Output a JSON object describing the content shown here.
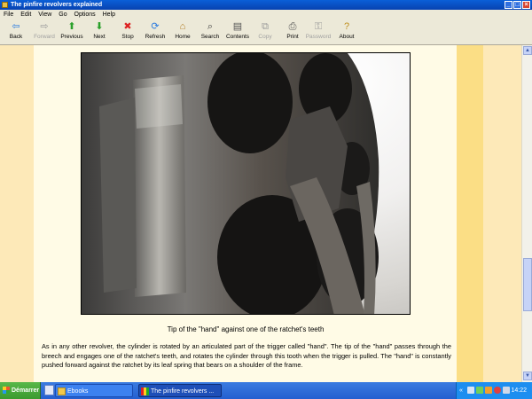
{
  "window": {
    "title": "The pinfire revolvers explained",
    "controls": [
      "_",
      "□",
      "×"
    ]
  },
  "menu": [
    "File",
    "Edit",
    "View",
    "Go",
    "Options",
    "Help"
  ],
  "toolbar": [
    {
      "label": "Back",
      "icon": "back-arrow-icon",
      "glyph": "⇦",
      "color": "#2a7be0",
      "enabled": true
    },
    {
      "label": "Forward",
      "icon": "forward-arrow-icon",
      "glyph": "⇨",
      "color": "#9a9a9a",
      "enabled": false
    },
    {
      "label": "Previous",
      "icon": "up-arrow-icon",
      "glyph": "⬆",
      "color": "#2aa02a",
      "enabled": true
    },
    {
      "label": "Next",
      "icon": "down-arrow-icon",
      "glyph": "⬇",
      "color": "#2aa02a",
      "enabled": true
    },
    {
      "label": "Stop",
      "icon": "stop-icon",
      "glyph": "✖",
      "color": "#d22",
      "enabled": true
    },
    {
      "label": "Refresh",
      "icon": "refresh-icon",
      "glyph": "⟳",
      "color": "#2a7be0",
      "enabled": true
    },
    {
      "label": "Home",
      "icon": "home-icon",
      "glyph": "⌂",
      "color": "#b07a20",
      "enabled": true
    },
    {
      "label": "Search",
      "icon": "search-icon",
      "glyph": "⌕",
      "color": "#444",
      "enabled": true
    },
    {
      "label": "Contents",
      "icon": "contents-icon",
      "glyph": "▤",
      "color": "#555",
      "enabled": true
    },
    {
      "label": "Copy",
      "icon": "copy-icon",
      "glyph": "⧉",
      "color": "#9a9a9a",
      "enabled": false
    },
    {
      "label": "Print",
      "icon": "print-icon",
      "glyph": "⎙",
      "color": "#555",
      "enabled": true
    },
    {
      "label": "Password",
      "icon": "password-icon",
      "glyph": "⚿",
      "color": "#9a9a9a",
      "enabled": false
    },
    {
      "label": "About",
      "icon": "about-icon",
      "glyph": "?",
      "color": "#c09020",
      "enabled": true
    }
  ],
  "page": {
    "image_alt": "revolver-cylinder-ratchet-photo",
    "caption": "Tip of the \"hand\" against one of the ratchet's teeth",
    "paragraph": "As in any other revolver, the cylinder is rotated by an articulated part of the trigger called \"hand\". The tip of the \"hand\" passes through the breech and engages one of the ratchet's teeth, and rotates the cylinder through this tooth when the trigger is pulled. The \"hand\" is constantly pushed forward against the ratchet by its leaf spring that bears on a shoulder of the frame."
  },
  "taskbar": {
    "start_label": "Démarrer",
    "tasks": [
      {
        "label": "Ebooks",
        "active": false,
        "icon": "folder-icon"
      },
      {
        "label": "The pinfire revolvers ...",
        "active": true,
        "icon": "ebook-icon"
      }
    ],
    "tray_chevron": "«",
    "clock": "14:22"
  },
  "colors": {
    "page_bg": "#fffbe6",
    "rail": "#fde9b8",
    "rail_accent": "#fbde85"
  }
}
